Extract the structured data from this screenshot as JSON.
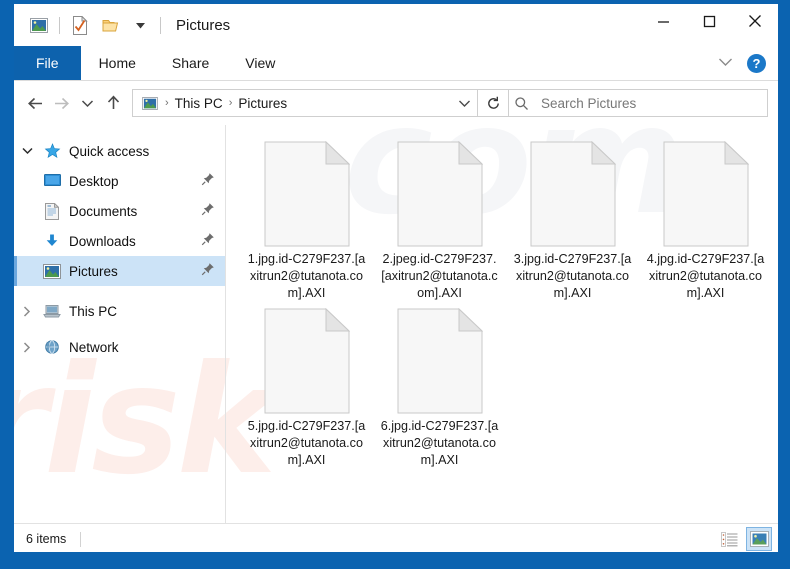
{
  "window": {
    "title": "Pictures",
    "quick_access_toolbar": [
      {
        "name": "pictures-icon",
        "icon": "pictures"
      },
      {
        "name": "properties-icon",
        "icon": "properties-check"
      },
      {
        "name": "new-folder-icon",
        "icon": "folder"
      },
      {
        "name": "customize-chevron-icon",
        "icon": "chevron-down"
      }
    ],
    "controls": {
      "minimize": "—",
      "maximize": "☐",
      "close": "✕"
    },
    "frame_color": "#0b63b0"
  },
  "ribbon": {
    "tabs": [
      {
        "label": "File",
        "active": true
      },
      {
        "label": "Home",
        "active": false
      },
      {
        "label": "Share",
        "active": false
      },
      {
        "label": "View",
        "active": false
      }
    ],
    "collapse_label": "⌄",
    "help_label": "?"
  },
  "address": {
    "back_tooltip": "Back",
    "forward_tooltip": "Forward",
    "recent_tooltip": "Recent locations",
    "up_tooltip": "Up",
    "breadcrumbs": [
      "This PC",
      "Pictures"
    ],
    "separator": "›",
    "refresh_label": "↻"
  },
  "search": {
    "placeholder": "Search Pictures",
    "value": ""
  },
  "sidebar": {
    "items": [
      {
        "label": "Quick access",
        "icon": "star-icon",
        "twisty": "expanded",
        "level": 0,
        "pinned": false,
        "selected": false
      },
      {
        "label": "Desktop",
        "icon": "desktop-icon",
        "twisty": "none",
        "level": 1,
        "pinned": true,
        "selected": false
      },
      {
        "label": "Documents",
        "icon": "documents-icon",
        "twisty": "none",
        "level": 1,
        "pinned": true,
        "selected": false
      },
      {
        "label": "Downloads",
        "icon": "downloads-icon",
        "twisty": "none",
        "level": 1,
        "pinned": true,
        "selected": false
      },
      {
        "label": "Pictures",
        "icon": "pictures-icon",
        "twisty": "none",
        "level": 1,
        "pinned": true,
        "selected": true
      },
      {
        "label": "This PC",
        "icon": "thispc-icon",
        "twisty": "collapsed",
        "level": 0,
        "pinned": false,
        "selected": false
      },
      {
        "label": "Network",
        "icon": "network-icon",
        "twisty": "collapsed",
        "level": 0,
        "pinned": false,
        "selected": false
      }
    ]
  },
  "files": [
    {
      "name": "1.jpg.id-C279F237.[axitrun2@tutanota.com].AXI",
      "icon": "blank-document-icon"
    },
    {
      "name": "2.jpeg.id-C279F237.[axitrun2@tutanota.com].AXI",
      "icon": "blank-document-icon"
    },
    {
      "name": "3.jpg.id-C279F237.[axitrun2@tutanota.com].AXI",
      "icon": "blank-document-icon"
    },
    {
      "name": "4.jpg.id-C279F237.[axitrun2@tutanota.com].AXI",
      "icon": "blank-document-icon"
    },
    {
      "name": "5.jpg.id-C279F237.[axitrun2@tutanota.com].AXI",
      "icon": "blank-document-icon"
    },
    {
      "name": "6.jpg.id-C279F237.[axitrun2@tutanota.com].AXI",
      "icon": "blank-document-icon"
    }
  ],
  "statusbar": {
    "item_count": "6 items",
    "views": [
      {
        "name": "details-view",
        "active": false
      },
      {
        "name": "large-icons-view",
        "active": true
      }
    ]
  },
  "watermark": {
    "left_text": "risk",
    "right_text": "com"
  }
}
